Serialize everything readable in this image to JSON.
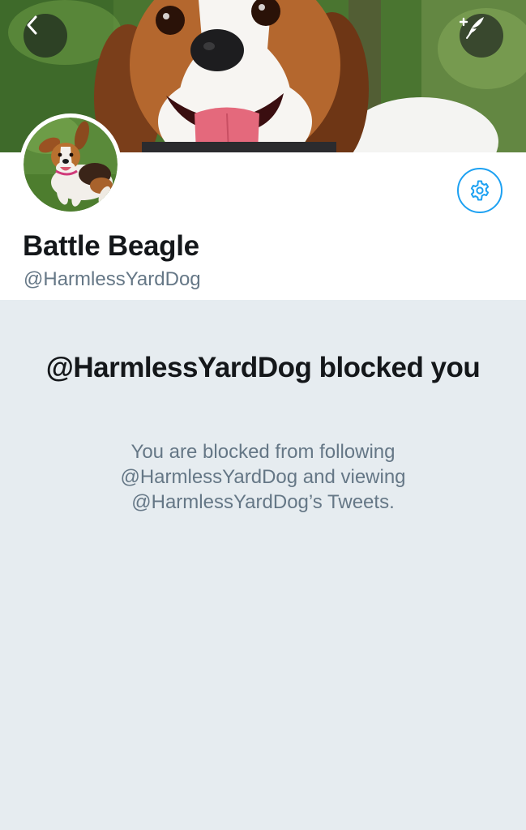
{
  "header": {
    "banner_image": "beagle-face-photo",
    "back_icon": "chevron-left-icon",
    "compose_icon": "compose-tweet-icon"
  },
  "profile": {
    "avatar_image": "running-beagle-photo",
    "settings_icon": "gear-icon",
    "display_name": "Battle Beagle",
    "handle": "@HarmlessYardDog"
  },
  "blocked": {
    "title": "@HarmlessYardDog blocked you",
    "body": "You are blocked from following @HarmlessYardDog and viewing @HarmlessYardDog’s Tweets."
  },
  "colors": {
    "accent": "#1da1f2",
    "primary_text": "#14171a",
    "secondary_text": "#657786",
    "background": "#e6ecf0"
  }
}
